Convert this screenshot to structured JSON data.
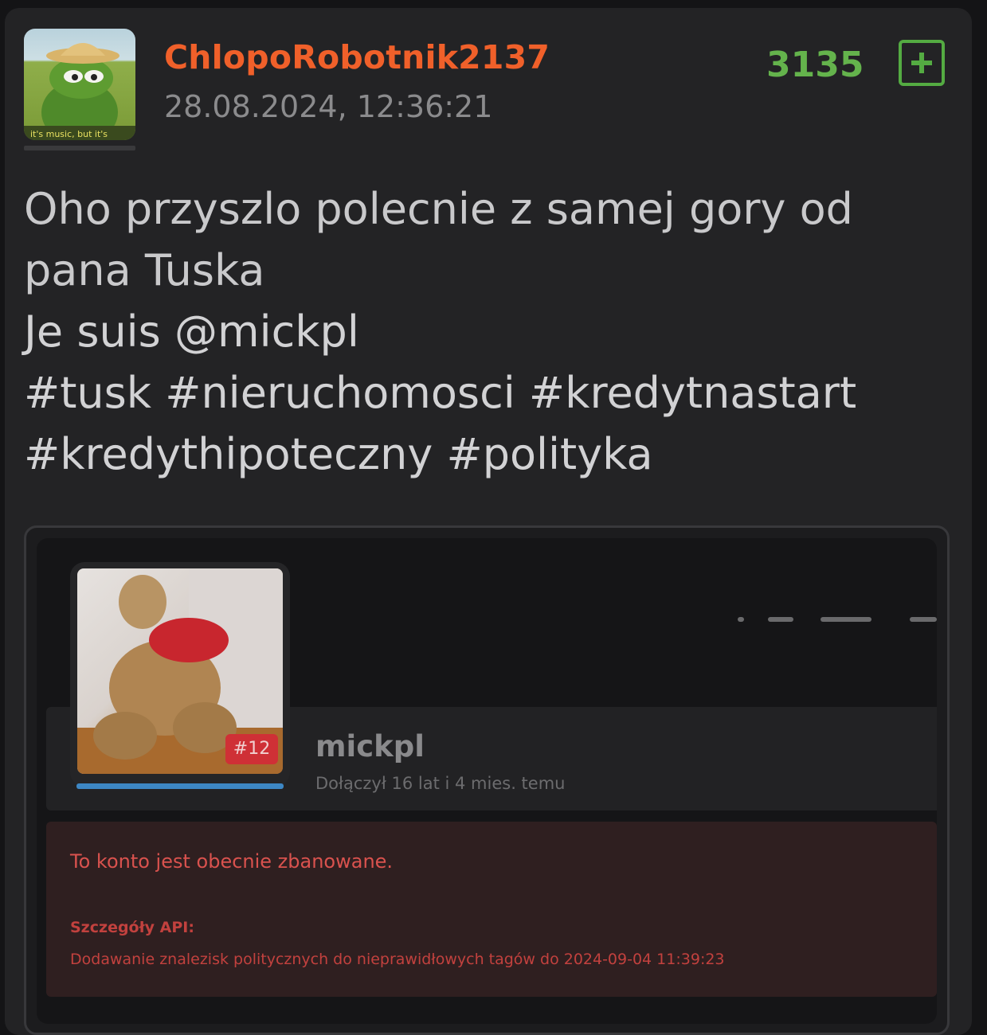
{
  "post": {
    "author": "ChlopoRobotnik2137",
    "timestamp": "28.08.2024, 12:36:21",
    "score": "3135",
    "vote_icon": "plus-square-icon",
    "content_lines": [
      "Oho przyszlo polecnie z samej gory od",
      "pana Tuska",
      "Je suis @mickpl",
      "#tusk #nieruchomosci #kredytnastart",
      "#kredythipoteczny #polityka"
    ]
  },
  "embedded_screenshot": {
    "profile_name": "mickpl",
    "joined": "Dołączył 16 lat i 4 mies. temu",
    "rank_badge": "#12",
    "ban_message": "To konto jest obecnie zbanowane.",
    "api_label": "Szczegóły API:",
    "api_detail": "Dodawanie znalezisk politycznych do nieprawidłowych tagów do 2024-09-04 11:39:23"
  },
  "colors": {
    "background": "#232325",
    "author": "#f0602a",
    "score": "#64b34c",
    "ban_text": "#d9524e"
  }
}
